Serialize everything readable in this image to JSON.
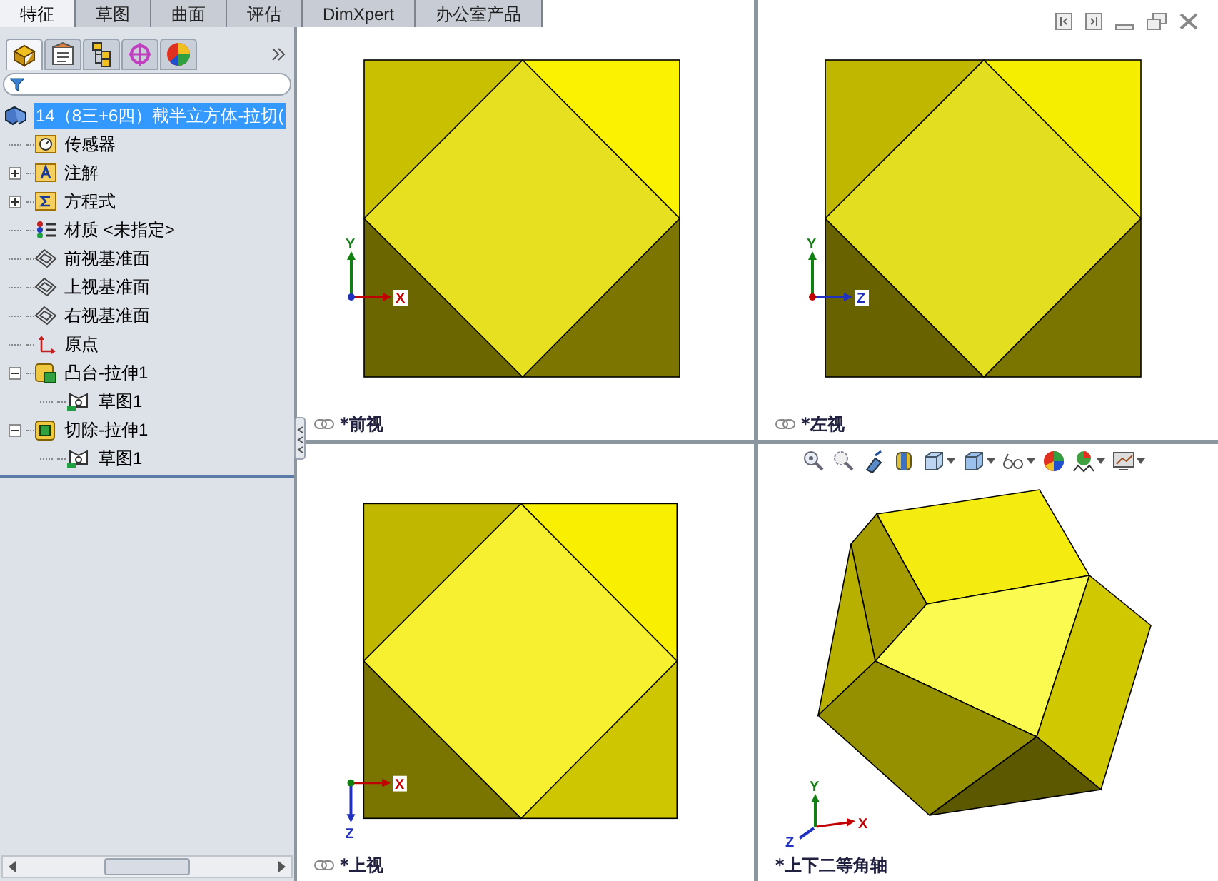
{
  "tabs": [
    {
      "label": "特征",
      "selected": true
    },
    {
      "label": "草图",
      "selected": false
    },
    {
      "label": "曲面",
      "selected": false
    },
    {
      "label": "评估",
      "selected": false
    },
    {
      "label": "DimXpert",
      "selected": false
    },
    {
      "label": "办公室产品",
      "selected": false
    }
  ],
  "panel_tabs": [
    {
      "kind": "features",
      "selected": true
    },
    {
      "kind": "properties",
      "selected": false
    },
    {
      "kind": "config",
      "selected": false
    },
    {
      "kind": "target",
      "selected": false
    },
    {
      "kind": "appearance",
      "selected": false
    }
  ],
  "feature_tree": {
    "root": {
      "label": "14（8三+6四）截半立方体-拉切(",
      "selected": true
    },
    "items": [
      {
        "kind": "sensor",
        "label": "传感器"
      },
      {
        "kind": "annotation",
        "label": "注解",
        "expanded": false
      },
      {
        "kind": "equation",
        "label": "方程式",
        "expanded": false
      },
      {
        "kind": "material",
        "label": "材质 <未指定>"
      },
      {
        "kind": "plane",
        "label": "前视基准面"
      },
      {
        "kind": "plane",
        "label": "上视基准面"
      },
      {
        "kind": "plane",
        "label": "右视基准面"
      },
      {
        "kind": "origin",
        "label": "原点"
      },
      {
        "kind": "boss",
        "label": "凸台-拉伸1",
        "expanded": true,
        "children": [
          {
            "kind": "sketch",
            "label": "草图1"
          }
        ]
      },
      {
        "kind": "cut",
        "label": "切除-拉伸1",
        "expanded": true,
        "children": [
          {
            "kind": "sketch",
            "label": "草图1"
          }
        ]
      }
    ]
  },
  "viewports": [
    {
      "kind": "front",
      "label": "*前视",
      "axis_labels": [
        "Y",
        "X"
      ]
    },
    {
      "kind": "left",
      "label": "*左视",
      "axis_labels": [
        "Y",
        "Z"
      ]
    },
    {
      "kind": "top",
      "label": "*上视",
      "axis_labels": [
        "Z",
        "X"
      ]
    },
    {
      "kind": "iso",
      "label": "*上下二等角轴",
      "axis_labels": [
        "Y",
        "X",
        "Z"
      ]
    }
  ]
}
